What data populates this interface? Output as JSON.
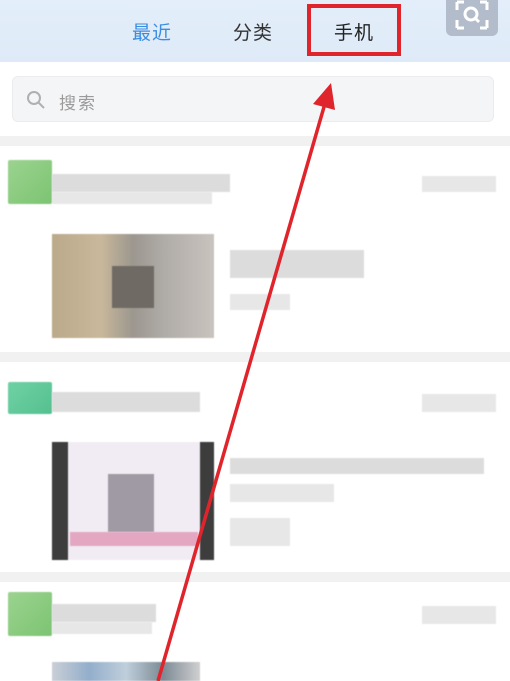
{
  "tabs": {
    "recent": "最近",
    "category": "分类",
    "phone": "手机"
  },
  "search": {
    "placeholder": "搜索"
  },
  "colors": {
    "accent": "#3b8de0",
    "highlight_box": "#e0242b",
    "arrow": "#e0242b"
  },
  "icons": {
    "scan": "scan-qr-icon",
    "search": "search-icon"
  }
}
